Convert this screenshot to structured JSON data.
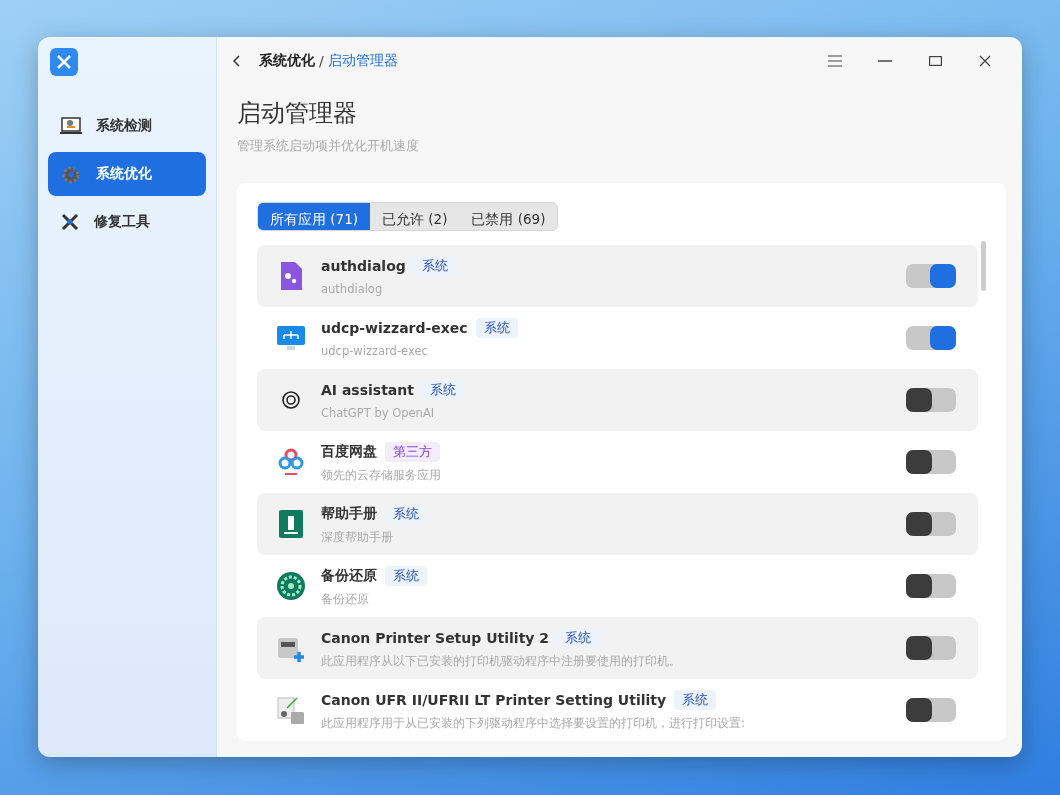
{
  "sidebar": {
    "items": [
      {
        "label": "系统检测",
        "selected": false
      },
      {
        "label": "系统优化",
        "selected": true
      },
      {
        "label": "修复工具",
        "selected": false
      }
    ]
  },
  "breadcrumb": {
    "parent": "系统优化",
    "separator": "/",
    "current": "启动管理器"
  },
  "page": {
    "title": "启动管理器",
    "subtitle": "管理系统启动项并优化开机速度"
  },
  "tabs": [
    {
      "label": "所有应用 (71)",
      "selected": true
    },
    {
      "label": "已允许 (2)",
      "selected": false
    },
    {
      "label": "已禁用 (69)",
      "selected": false
    }
  ],
  "apps": [
    {
      "name": "authdialog",
      "tag": "系统",
      "kind": "system",
      "description": "authdialog",
      "on": true
    },
    {
      "name": "udcp-wizzard-exec",
      "tag": "系统",
      "kind": "system",
      "description": "udcp-wizzard-exec",
      "on": true
    },
    {
      "name": "AI assistant",
      "tag": "系统",
      "kind": "system",
      "description": "ChatGPT by OpenAI",
      "on": false
    },
    {
      "name": "百度网盘",
      "tag": "第三方",
      "kind": "third_party",
      "description": "领先的云存储服务应用",
      "on": false
    },
    {
      "name": "帮助手册",
      "tag": "系统",
      "kind": "system",
      "description": "深度帮助手册",
      "on": false
    },
    {
      "name": "备份还原",
      "tag": "系统",
      "kind": "system",
      "description": "备份还原",
      "on": false
    },
    {
      "name": "Canon Printer Setup Utility 2",
      "tag": "系统",
      "kind": "system",
      "description": "此应用程序从以下已安装的打印机驱动程序中注册要使用的打印机。",
      "on": false
    },
    {
      "name": "Canon UFR II/UFRII LT Printer Setting Utility",
      "tag": "系统",
      "kind": "system",
      "description": "此应用程序用于从已安装的下列驱动程序中选择要设置的打印机，进行打印设置:",
      "on": false
    }
  ]
}
